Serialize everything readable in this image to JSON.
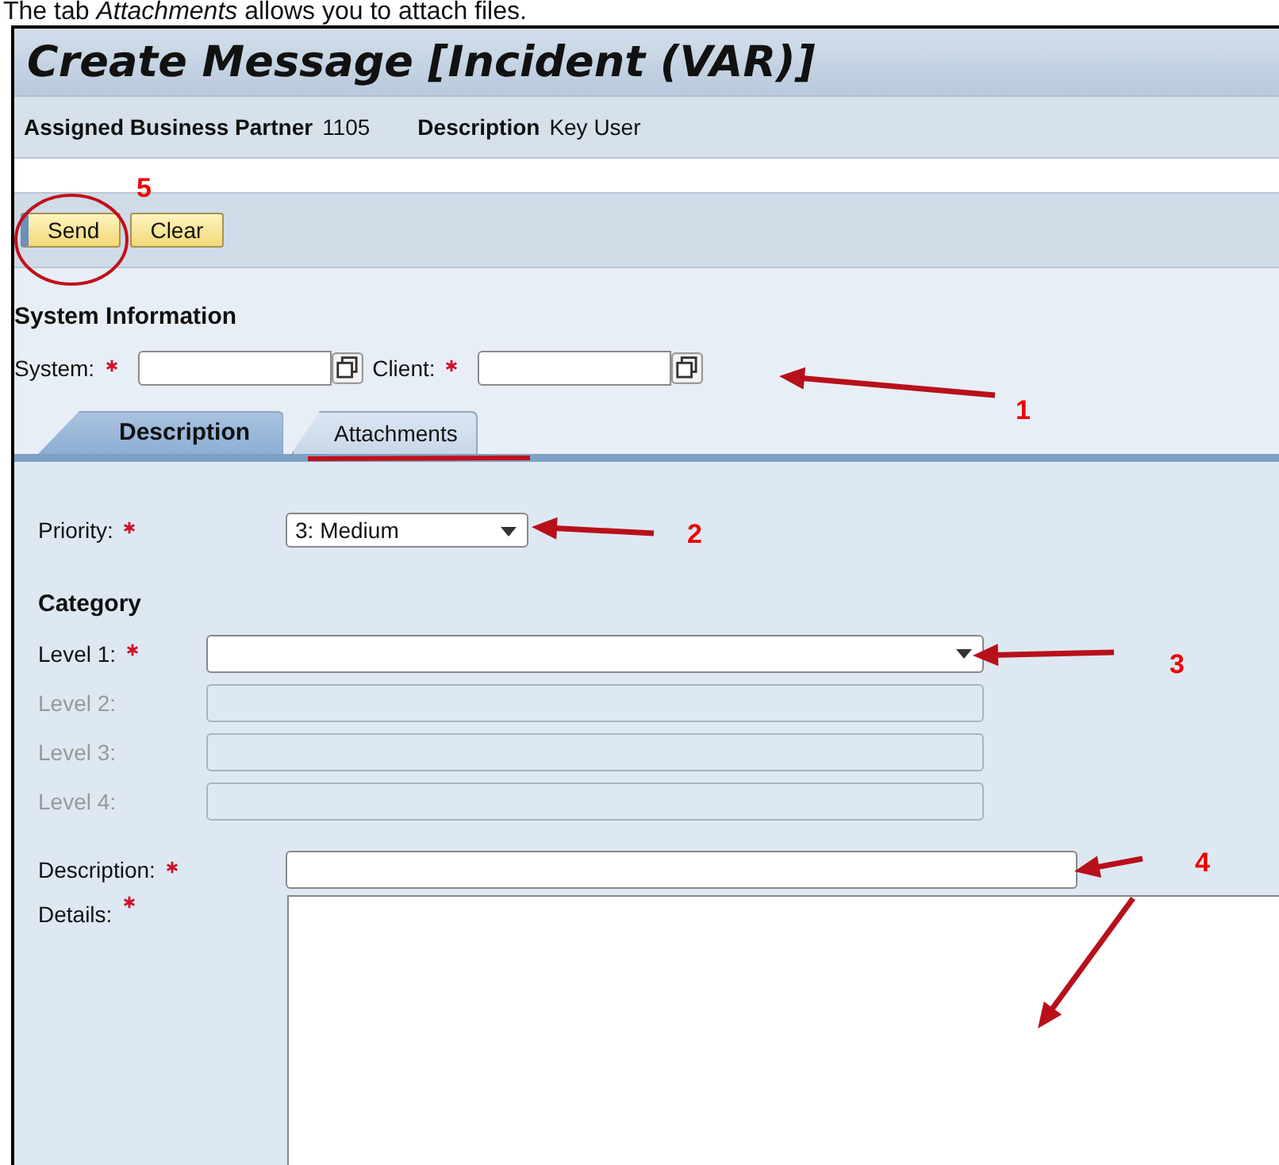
{
  "caption": "The tab *Attachments* allows you to attach files.",
  "title": "Create Message [Incident (VAR)]",
  "header_fields": [
    {
      "label": "Assigned Business Partner",
      "value": "1105"
    },
    {
      "label": "Description",
      "value": "Key User"
    }
  ],
  "toolbar": [
    {
      "label": "Send"
    },
    {
      "label": "Clear"
    }
  ],
  "system_information": {
    "title": "System Information",
    "fields": [
      {
        "label": "System:",
        "required": true
      },
      {
        "label": "Client:",
        "required": true
      }
    ]
  },
  "tabs": [
    {
      "label": "Description",
      "selected": true,
      "underlined": false
    },
    {
      "label": "Attachments",
      "selected": false,
      "underlined": true
    }
  ],
  "priority": {
    "label": "Priority:",
    "required": true,
    "value": "3: Medium"
  },
  "category": {
    "title": "Category",
    "levels": [
      {
        "label": "Level 1:",
        "required": true,
        "disabled": false
      },
      {
        "label": "Level 2:",
        "required": false,
        "disabled": true
      },
      {
        "label": "Level 3:",
        "required": false,
        "disabled": true
      },
      {
        "label": "Level 4:",
        "required": false,
        "disabled": true
      }
    ]
  },
  "description": {
    "label": "Description:",
    "required": true
  },
  "details": {
    "label": "Details:",
    "required": true
  },
  "annotations": [
    {
      "number": "5",
      "kind": "circle"
    },
    {
      "number": "1",
      "kind": "arrow"
    },
    {
      "number": "2",
      "kind": "arrow"
    },
    {
      "number": "3",
      "kind": "arrow"
    },
    {
      "number": "4",
      "kind": "double_arrow"
    }
  ]
}
